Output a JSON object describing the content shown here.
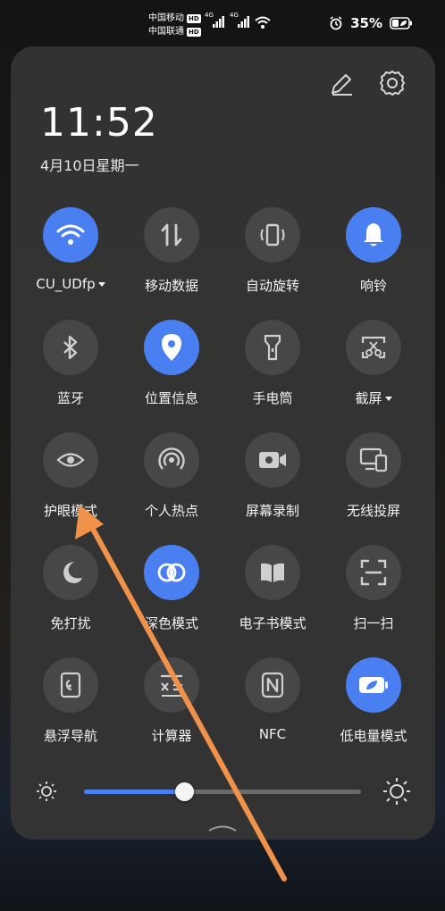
{
  "status_bar": {
    "carrier1": "中国移动",
    "carrier2": "中国联通",
    "hd": "HD",
    "net1": "4G",
    "net2": "4G",
    "battery": "35%"
  },
  "header": {
    "time": "11:52",
    "date": "4月10日星期一"
  },
  "toggles": [
    {
      "label": "CU_UDfp",
      "icon": "wifi-icon",
      "on": true,
      "caret": true
    },
    {
      "label": "移动数据",
      "icon": "mobile-data-icon",
      "on": false
    },
    {
      "label": "自动旋转",
      "icon": "auto-rotate-icon",
      "on": false
    },
    {
      "label": "响铃",
      "icon": "bell-icon",
      "on": true
    },
    {
      "label": "蓝牙",
      "icon": "bluetooth-icon",
      "on": false
    },
    {
      "label": "位置信息",
      "icon": "location-icon",
      "on": true
    },
    {
      "label": "手电筒",
      "icon": "flashlight-icon",
      "on": false
    },
    {
      "label": "截屏",
      "icon": "screenshot-icon",
      "on": false,
      "caret": true
    },
    {
      "label": "护眼模式",
      "icon": "eye-comfort-icon",
      "on": false
    },
    {
      "label": "个人热点",
      "icon": "hotspot-icon",
      "on": false
    },
    {
      "label": "屏幕录制",
      "icon": "screen-record-icon",
      "on": false
    },
    {
      "label": "无线投屏",
      "icon": "wireless-projection-icon",
      "on": false
    },
    {
      "label": "免打扰",
      "icon": "moon-icon",
      "on": false
    },
    {
      "label": "深色模式",
      "icon": "dark-mode-icon",
      "on": true
    },
    {
      "label": "电子书模式",
      "icon": "ebook-icon",
      "on": false
    },
    {
      "label": "扫一扫",
      "icon": "scan-icon",
      "on": false
    },
    {
      "label": "悬浮导航",
      "icon": "floating-nav-icon",
      "on": false
    },
    {
      "label": "计算器",
      "icon": "calculator-icon",
      "on": false
    },
    {
      "label": "NFC",
      "icon": "nfc-icon",
      "on": false
    },
    {
      "label": "低电量模式",
      "icon": "battery-saver-icon",
      "on": true
    }
  ],
  "brightness": {
    "level": 0.36
  },
  "colors": {
    "accent": "#4a7ff1",
    "tile_off": "#474747",
    "panel": "#343434",
    "annotation_arrow": "#f0924a"
  }
}
